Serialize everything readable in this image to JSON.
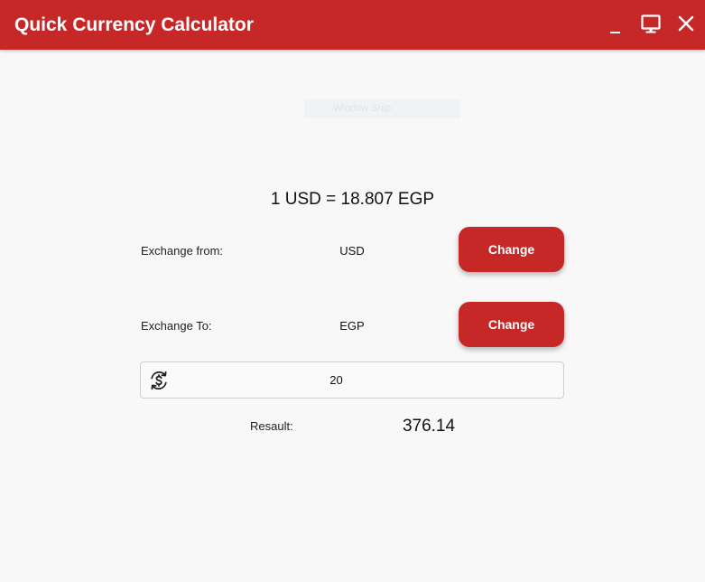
{
  "window": {
    "title": "Quick Currency Calculator",
    "accent_color": "#c62828",
    "controls": {
      "minimize_icon": "minimize-icon",
      "maximize_icon": "monitor-icon",
      "close_icon": "close-icon"
    }
  },
  "overlay": {
    "snip_tooltip": "Window Snip"
  },
  "rate": {
    "text": "1 USD = 18.807 EGP"
  },
  "exchange_from": {
    "label": "Exchange from:",
    "currency": "USD",
    "button_label": "Change"
  },
  "exchange_to": {
    "label": "Exchange To:",
    "currency": "EGP",
    "button_label": "Change"
  },
  "amount": {
    "icon": "currency-exchange-icon",
    "value": "20"
  },
  "result": {
    "label": "Resault:",
    "value": "376.14"
  }
}
